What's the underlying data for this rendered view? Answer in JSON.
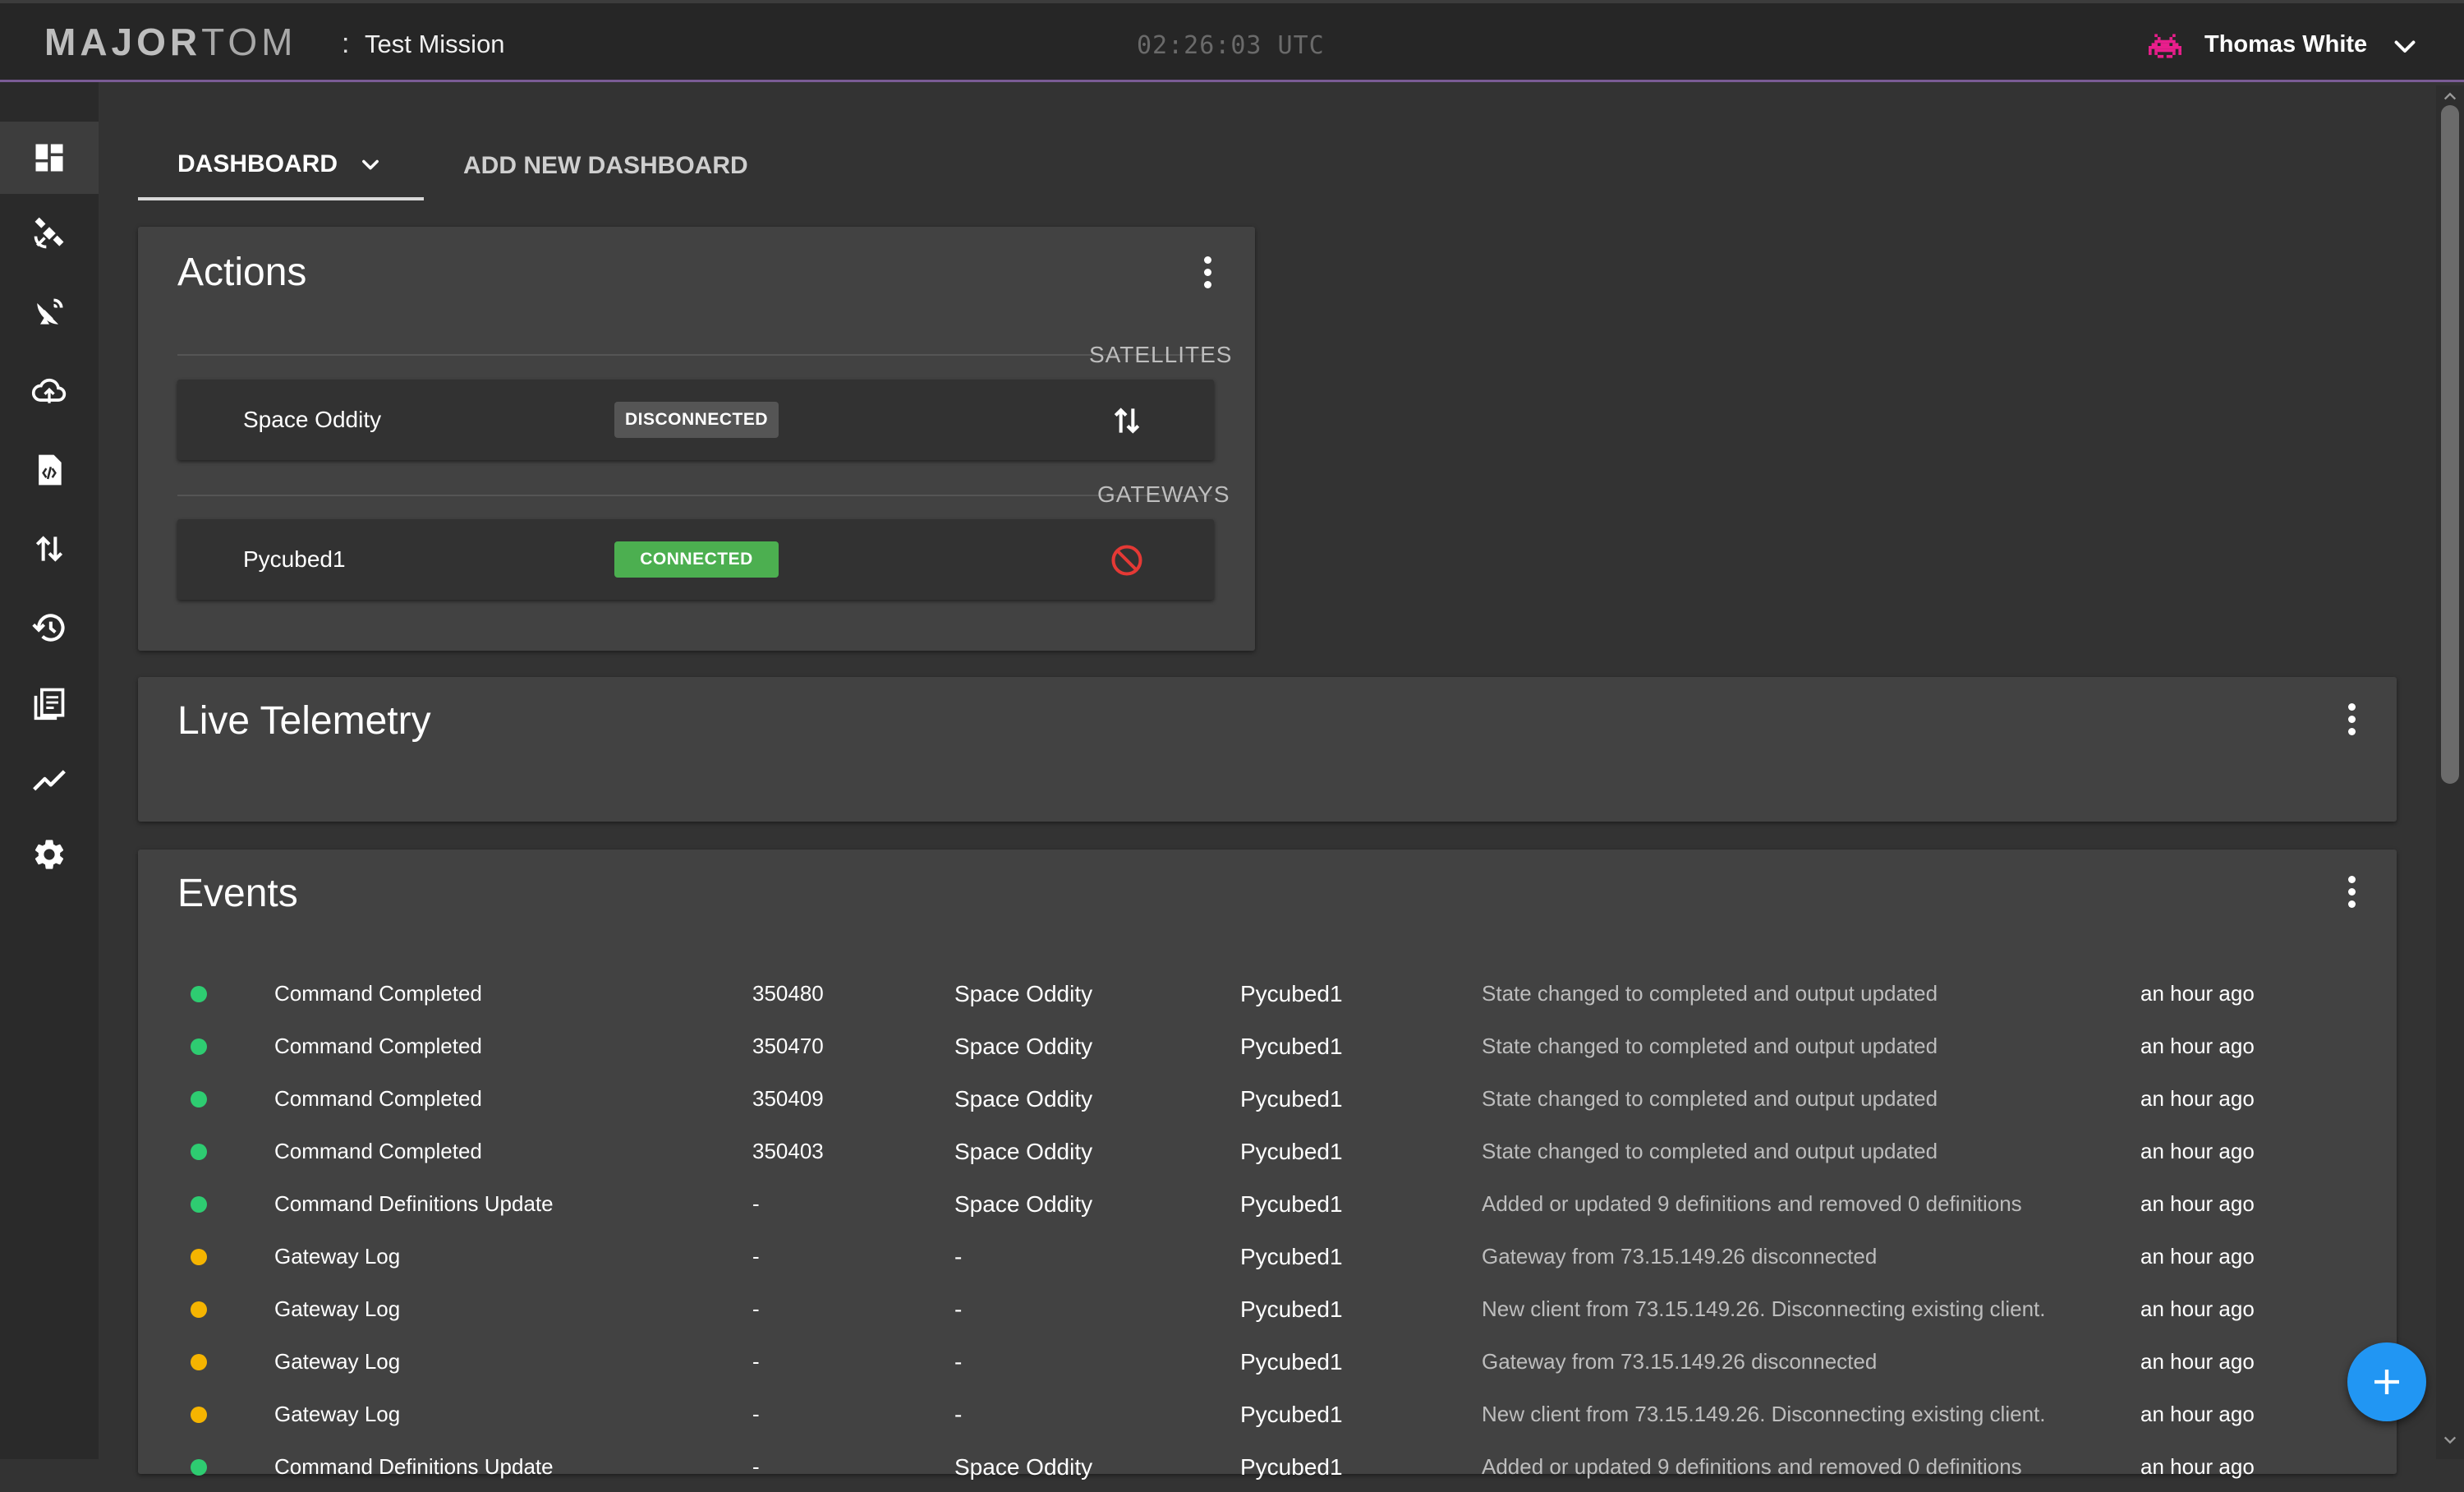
{
  "header": {
    "brand_bold": "MAJOR",
    "brand_light": "TOM",
    "separator": ":",
    "mission": "Test Mission",
    "clock": "02:26:03 UTC",
    "user_name": "Thomas White",
    "icons": {
      "avatar": "space-invader-icon",
      "menu": "chevron-down-icon"
    }
  },
  "sidebar": {
    "items": [
      {
        "icon": "dashboard-icon",
        "active": true
      },
      {
        "icon": "satellite-icon",
        "active": false
      },
      {
        "icon": "satellite-dish-icon",
        "active": false
      },
      {
        "icon": "cloud-sync-icon",
        "active": false
      },
      {
        "icon": "code-file-icon",
        "active": false
      },
      {
        "icon": "uplink-downlink-icon",
        "active": false
      },
      {
        "icon": "history-icon",
        "active": false
      },
      {
        "icon": "documents-icon",
        "active": false
      },
      {
        "icon": "trend-chart-icon",
        "active": false
      },
      {
        "icon": "gear-icon",
        "active": false
      }
    ]
  },
  "tabs": {
    "dashboard": "DASHBOARD",
    "add_new": "ADD NEW DASHBOARD"
  },
  "actions": {
    "title": "Actions",
    "satellites_label": "SATELLITES",
    "gateways_label": "GATEWAYS",
    "satellite": {
      "name": "Space Oddity",
      "status": "DISCONNECTED",
      "action_icon": "up-down-arrows-icon"
    },
    "gateway": {
      "name": "Pycubed1",
      "status": "CONNECTED",
      "action_icon": "block-icon"
    }
  },
  "live_telemetry": {
    "title": "Live Telemetry"
  },
  "events": {
    "title": "Events",
    "colors": {
      "success": "#2ecc71",
      "warning": "#f5b400"
    },
    "rows": [
      {
        "level": "success",
        "type": "Command Completed",
        "id": "350480",
        "system": "Space Oddity",
        "gateway": "Pycubed1",
        "message": "State changed to completed and output updated",
        "time": "an hour ago"
      },
      {
        "level": "success",
        "type": "Command Completed",
        "id": "350470",
        "system": "Space Oddity",
        "gateway": "Pycubed1",
        "message": "State changed to completed and output updated",
        "time": "an hour ago"
      },
      {
        "level": "success",
        "type": "Command Completed",
        "id": "350409",
        "system": "Space Oddity",
        "gateway": "Pycubed1",
        "message": "State changed to completed and output updated",
        "time": "an hour ago"
      },
      {
        "level": "success",
        "type": "Command Completed",
        "id": "350403",
        "system": "Space Oddity",
        "gateway": "Pycubed1",
        "message": "State changed to completed and output updated",
        "time": "an hour ago"
      },
      {
        "level": "success",
        "type": "Command Definitions Update",
        "id": "-",
        "system": "Space Oddity",
        "gateway": "Pycubed1",
        "message": "Added or updated 9 definitions and removed 0 definitions",
        "time": "an hour ago"
      },
      {
        "level": "warning",
        "type": "Gateway Log",
        "id": "-",
        "system": "-",
        "gateway": "Pycubed1",
        "message": "Gateway from 73.15.149.26 disconnected",
        "time": "an hour ago"
      },
      {
        "level": "warning",
        "type": "Gateway Log",
        "id": "-",
        "system": "-",
        "gateway": "Pycubed1",
        "message": "New client from 73.15.149.26. Disconnecting existing client.",
        "time": "an hour ago"
      },
      {
        "level": "warning",
        "type": "Gateway Log",
        "id": "-",
        "system": "-",
        "gateway": "Pycubed1",
        "message": "Gateway from 73.15.149.26 disconnected",
        "time": "an hour ago"
      },
      {
        "level": "warning",
        "type": "Gateway Log",
        "id": "-",
        "system": "-",
        "gateway": "Pycubed1",
        "message": "New client from 73.15.149.26. Disconnecting existing client.",
        "time": "an hour ago"
      },
      {
        "level": "success",
        "type": "Command Definitions Update",
        "id": "-",
        "system": "Space Oddity",
        "gateway": "Pycubed1",
        "message": "Added or updated 9 definitions and removed 0 definitions",
        "time": "an hour ago"
      }
    ]
  },
  "fab": {
    "icon": "plus-icon"
  }
}
